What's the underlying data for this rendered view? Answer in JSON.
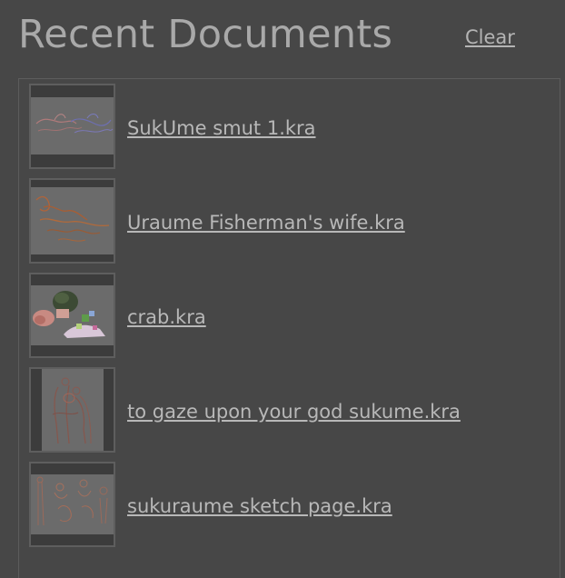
{
  "header": {
    "title": "Recent Documents",
    "clear_label": "Clear"
  },
  "documents": [
    {
      "name": "SukUme smut 1.kra",
      "thumbnail_icon": "sketch-thumbnail-icon"
    },
    {
      "name": "Uraume Fisherman's wife.kra",
      "thumbnail_icon": "sketch-thumbnail-icon"
    },
    {
      "name": "crab.kra",
      "thumbnail_icon": "painting-thumbnail-icon"
    },
    {
      "name": "to gaze upon your god sukume.kra",
      "thumbnail_icon": "sketch-thumbnail-icon"
    },
    {
      "name": "sukuraume sketch page.kra",
      "thumbnail_icon": "sketch-thumbnail-icon"
    }
  ],
  "colors": {
    "background": "#474747",
    "title_text": "#a9a9a9",
    "link_text": "#b8b8b8",
    "border": "#5c5c5c"
  }
}
